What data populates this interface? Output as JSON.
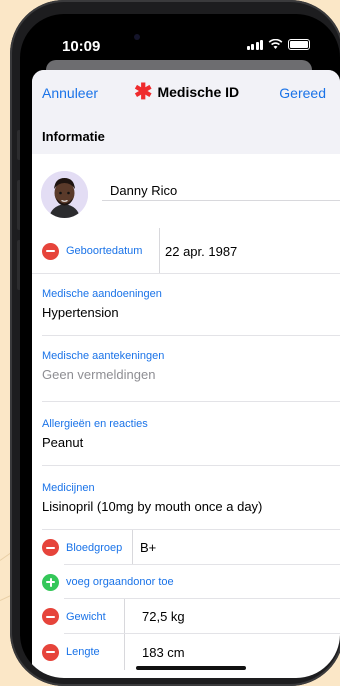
{
  "status": {
    "time": "10:09"
  },
  "nav": {
    "cancel": "Annuleer",
    "title": "Medische ID",
    "done": "Gereed"
  },
  "section": {
    "info": "Informatie"
  },
  "profile": {
    "name": "Danny Rico"
  },
  "birthdate": {
    "label": "Geboortedatum",
    "value": "22 apr. 1987"
  },
  "conditions": {
    "label": "Medische aandoeningen",
    "value": "Hypertension"
  },
  "notes": {
    "label": "Medische aantekeningen",
    "placeholder": "Geen vermeldingen"
  },
  "allergies": {
    "label": "Allergieën en reacties",
    "value": "Peanut"
  },
  "medications": {
    "label": "Medicijnen",
    "value": "Lisinopril (10mg by mouth once a day)"
  },
  "blood": {
    "label": "Bloedgroep",
    "value": "B+"
  },
  "organ": {
    "label": "voeg orgaandonor toe"
  },
  "weight": {
    "label": "Gewicht",
    "value": "72,5 kg"
  },
  "height": {
    "label": "Lengte",
    "value": "183 cm"
  },
  "colors": {
    "accent": "#1a73e8",
    "remove": "#e6443b",
    "add": "#34c759",
    "medical_star": "#ef2b2d"
  },
  "icons": {
    "remove": "minus-circle-icon",
    "add": "plus-circle-icon",
    "medical": "asterisk-icon",
    "avatar": "memoji-avatar"
  }
}
